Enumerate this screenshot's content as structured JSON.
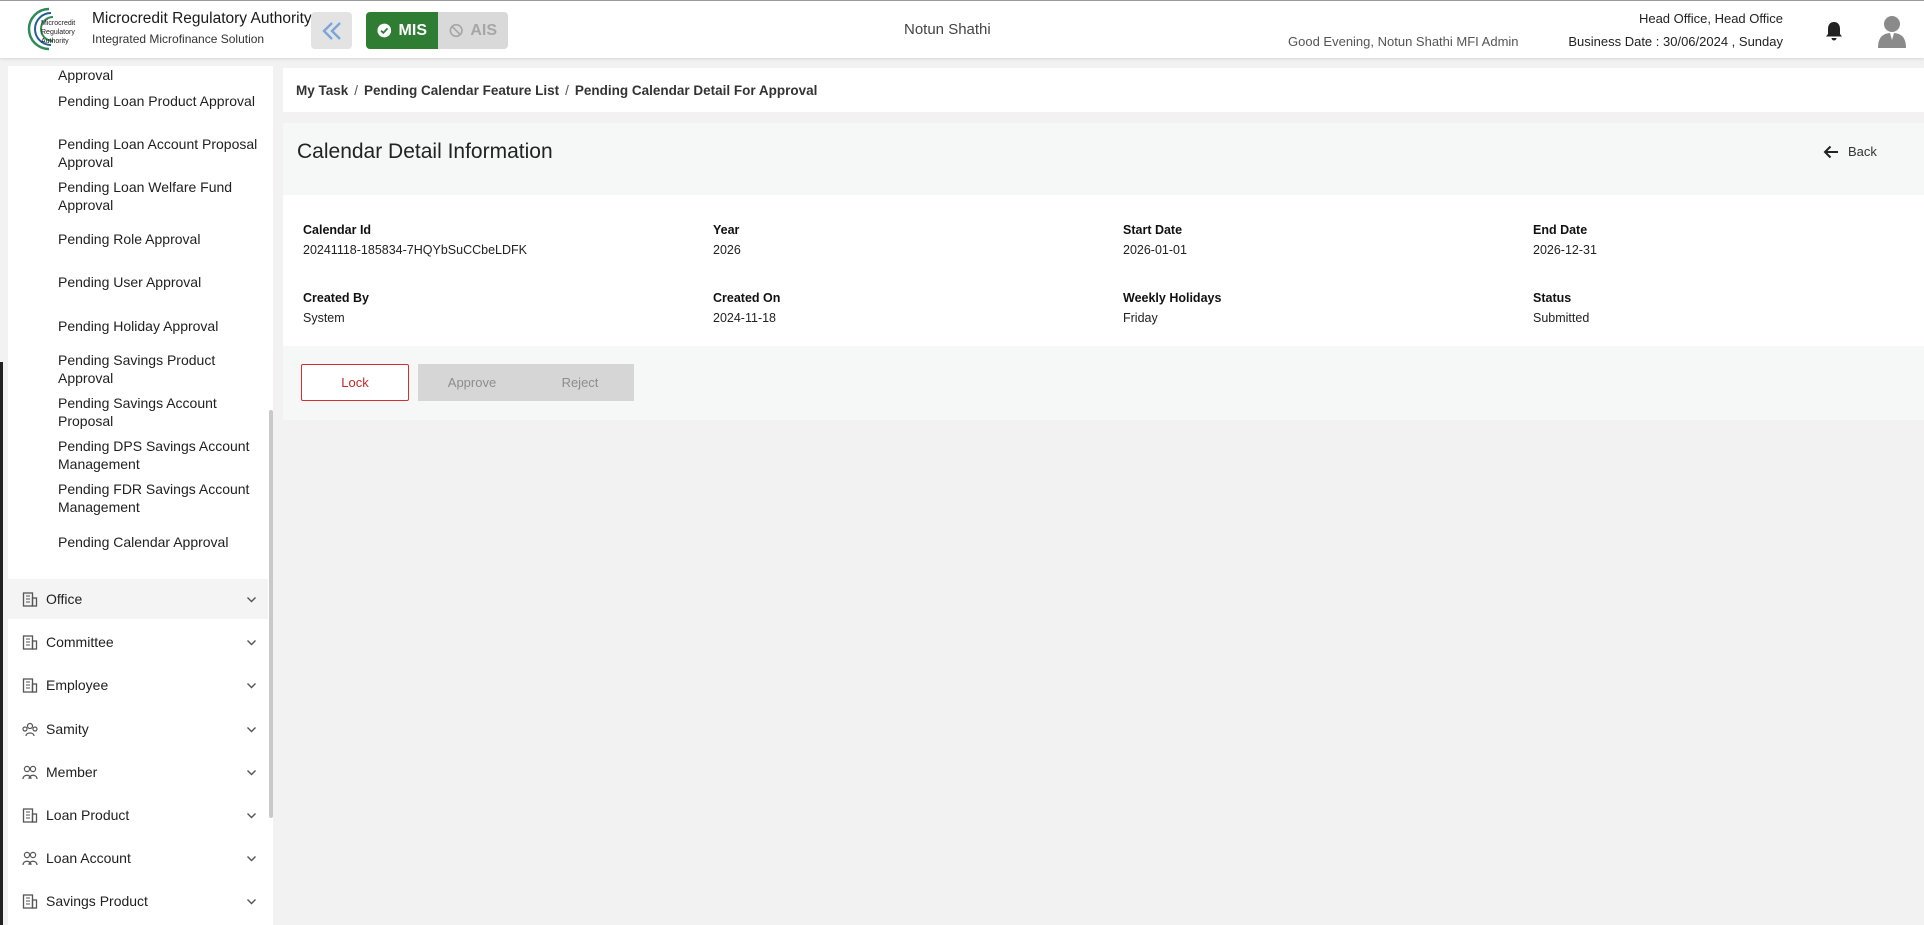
{
  "header": {
    "brand_title": "Microcredit Regulatory Authority",
    "brand_subtitle": "Integrated Microfinance Solution",
    "logo_text_1": "Microcredit",
    "logo_text_2": "Regulatory",
    "logo_text_3": "Authority",
    "mode_mis": "MIS",
    "mode_ais": "AIS",
    "organization": "Notun Shathi",
    "greeting": "Good Evening, Notun Shathi MFI Admin",
    "office": "Head Office, Head Office",
    "business_date": "Business Date : 30/06/2024 , Sunday"
  },
  "sidebar": {
    "sub_items": [
      "Approval",
      "Pending Loan Product Approval",
      "Pending Loan Account Proposal Approval",
      "Pending Loan Welfare Fund Approval",
      "Pending Role Approval",
      "Pending User Approval",
      "Pending Holiday Approval",
      "Pending Savings Product Approval",
      "Pending Savings Account Proposal",
      "Pending DPS Savings Account Management",
      "Pending FDR Savings Account Management",
      "Pending Calendar Approval"
    ],
    "menu": [
      {
        "label": "Office",
        "icon": "building-icon"
      },
      {
        "label": "Committee",
        "icon": "building-icon"
      },
      {
        "label": "Employee",
        "icon": "building-icon"
      },
      {
        "label": "Samity",
        "icon": "group-icon"
      },
      {
        "label": "Member",
        "icon": "people-icon"
      },
      {
        "label": "Loan Product",
        "icon": "building-icon"
      },
      {
        "label": "Loan Account",
        "icon": "people-icon"
      },
      {
        "label": "Savings Product",
        "icon": "building-icon"
      }
    ]
  },
  "breadcrumb": {
    "items": [
      "My Task",
      "Pending Calendar Feature List",
      "Pending Calendar Detail For Approval"
    ],
    "separator": "/"
  },
  "detail": {
    "title": "Calendar Detail Information",
    "back_label": "Back",
    "fields": [
      {
        "label": "Calendar Id",
        "value": "20241118-185834-7HQYbSuCCbeLDFK"
      },
      {
        "label": "Year",
        "value": "2026"
      },
      {
        "label": "Start Date",
        "value": "2026-01-01"
      },
      {
        "label": "End Date",
        "value": "2026-12-31"
      },
      {
        "label": "Created By",
        "value": "System"
      },
      {
        "label": "Created On",
        "value": "2024-11-18"
      },
      {
        "label": "Weekly Holidays",
        "value": "Friday"
      },
      {
        "label": "Status",
        "value": "Submitted"
      }
    ]
  },
  "actions": {
    "lock": "Lock",
    "approve": "Approve",
    "reject": "Reject"
  },
  "colors": {
    "mis_green": "#2e7d32",
    "lock_red": "#d32f2f",
    "logo_green": "#2e8b57"
  }
}
